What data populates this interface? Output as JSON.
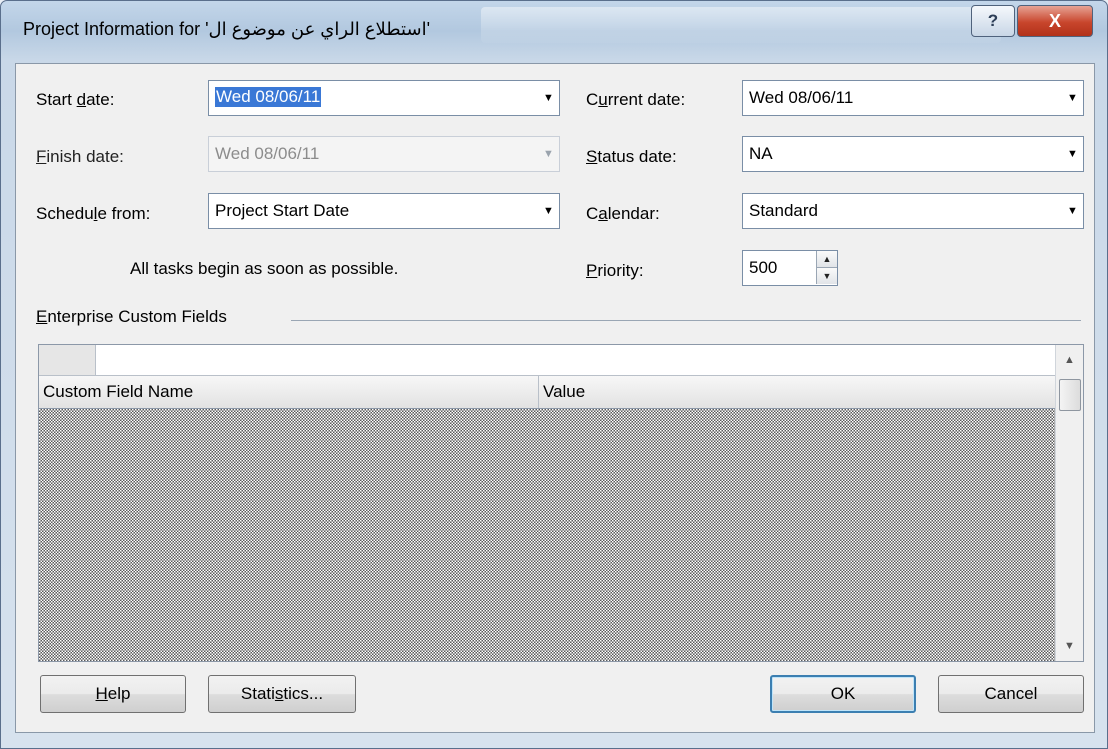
{
  "window": {
    "title": "Project Information for 'استطلاع الراي عن موضوع ال'",
    "help_glyph": "?",
    "close_glyph": "X"
  },
  "form": {
    "start_date": {
      "label_pre": "Start ",
      "label_key": "d",
      "label_post": "ate:",
      "value": "Wed 08/06/11"
    },
    "finish_date": {
      "label_pre": "",
      "label_key": "F",
      "label_post": "inish date:",
      "value": "Wed 08/06/11"
    },
    "schedule_from": {
      "label_pre": "Schedu",
      "label_key": "l",
      "label_post": "e from:",
      "value": "Project Start Date"
    },
    "schedule_note": "All tasks begin as soon as possible.",
    "current_date": {
      "label_pre": "C",
      "label_key": "u",
      "label_post": "rrent date:",
      "value": "Wed 08/06/11"
    },
    "status_date": {
      "label_pre": "",
      "label_key": "S",
      "label_post": "tatus date:",
      "value": "NA"
    },
    "calendar": {
      "label_pre": "C",
      "label_key": "a",
      "label_post": "lendar:",
      "value": "Standard"
    },
    "priority": {
      "label_pre": "",
      "label_key": "P",
      "label_post": "riority:",
      "value": "500"
    }
  },
  "custom_fields": {
    "group_pre": "",
    "group_key": "E",
    "group_post": "nterprise Custom Fields",
    "columns": [
      "Custom Field Name",
      "Value"
    ]
  },
  "buttons": {
    "help": {
      "pre": "",
      "key": "H",
      "post": "elp"
    },
    "statistics": {
      "pre": "Stati",
      "key": "s",
      "post": "tics..."
    },
    "ok": "OK",
    "cancel": "Cancel"
  },
  "icons": {
    "dropdown": "▼",
    "spin_up": "▲",
    "spin_down": "▼",
    "scroll_up": "▲",
    "scroll_down": "▼"
  }
}
